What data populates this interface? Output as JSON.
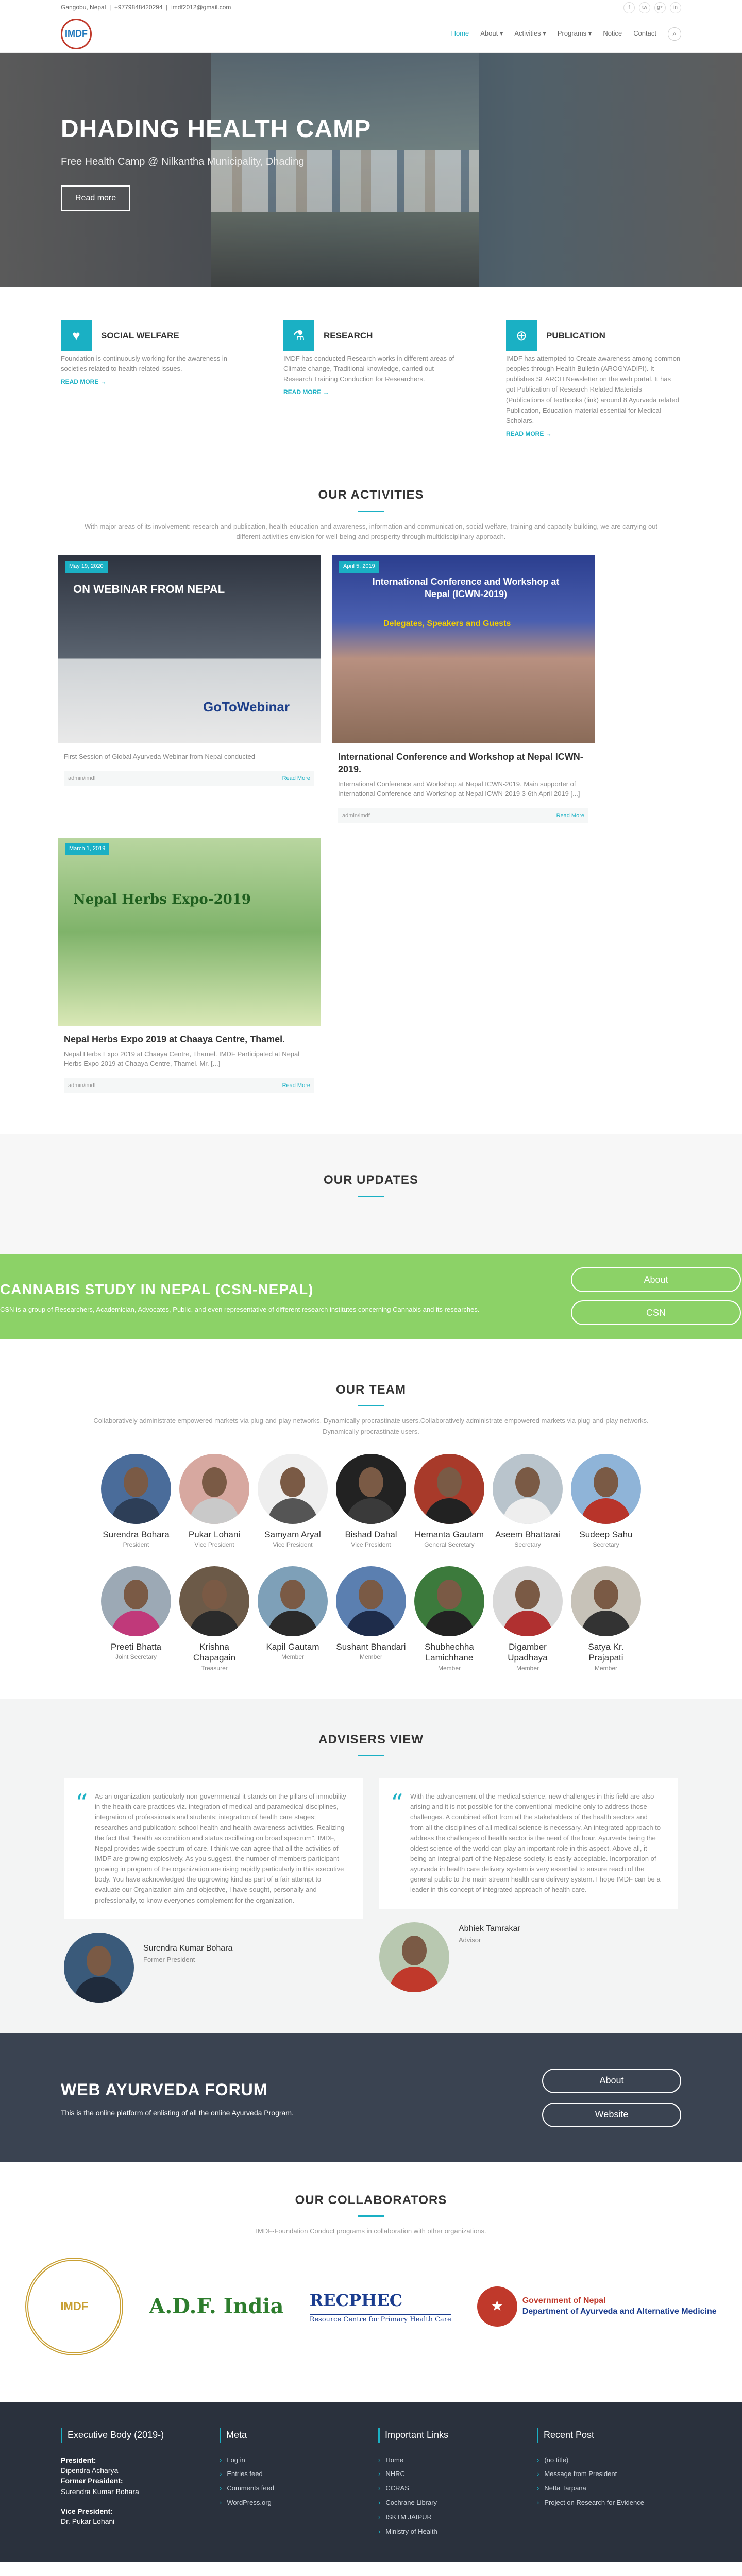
{
  "topbar": {
    "address": "Gangobu, Nepal",
    "phone": "+9779848420294",
    "email": "imdf2012@gmail.com",
    "social": [
      "f",
      "tw",
      "g+",
      "in"
    ]
  },
  "nav": {
    "logo_text": "IMDF",
    "items": [
      "Home",
      "About",
      "Activities",
      "Programs",
      "Notice",
      "Contact"
    ]
  },
  "hero": {
    "title": "DHADING HEALTH CAMP",
    "subtitle": "Free Health Camp @ Nilkantha Municipality, Dhading",
    "button": "Read more"
  },
  "features": [
    {
      "title": "SOCIAL WELFARE",
      "text": "Foundation is continuously working for the awareness in societies related to health-related issues.",
      "more": "READ MORE"
    },
    {
      "title": "RESEARCH",
      "text": "IMDF has conducted Research works in different areas of Climate change, Traditional knowledge, carried out Research Training Conduction for Researchers.",
      "more": "READ MORE"
    },
    {
      "title": "PUBLICATION",
      "text": "IMDF has attempted to Create awareness among common peoples through Health Bulletin (AROGYADIPI). It publishes SEARCH Newsletter on the web portal. It has got Publication of Research Related Materials (Publications of textbooks (link) around 8 Ayurveda related Publication, Education material essential for Medical Scholars.",
      "more": "READ MORE"
    }
  ],
  "activities": {
    "title": "OUR ACTIVITIES",
    "subtitle": "With major areas of its involvement: research and publication, health education and awareness, information and communication, social welfare, training and capacity building, we are carrying out different activities envision for well-being and prosperity through multidisciplinary approach.",
    "cards": [
      {
        "date": "May 19, 2020",
        "img_title": "ON WEBINAR FROM NEPAL",
        "img_sub": "GoToWebinar",
        "title": "",
        "text": "First Session of Global Ayurveda Webinar from Nepal conducted",
        "author": "admin/imdf",
        "more": "Read More"
      },
      {
        "date": "April 5, 2019",
        "img_title": "International Conference and Workshop at Nepal (ICWN-2019)",
        "img_sub": "Delegates, Speakers and Guests",
        "title": "International Conference and Workshop at Nepal ICWN-2019.",
        "text": "International Conference and Workshop at Nepal ICWN-2019. Main supporter of International Conference and Workshop at Nepal ICWN-2019 3-6th April 2019 [...]",
        "author": "admin/imdf",
        "more": "Read More"
      },
      {
        "date": "March 1, 2019",
        "img_title": "Nepal Herbs Expo-2019",
        "img_sub": "",
        "title": "Nepal Herbs Expo 2019 at Chaaya Centre, Thamel.",
        "text": "Nepal Herbs Expo 2019 at Chaaya Centre, Thamel. IMDF Participated at Nepal Herbs Expo 2019 at Chaaya Centre, Thamel. Mr. [...]",
        "author": "admin/imdf",
        "more": "Read More"
      }
    ]
  },
  "updates": {
    "title": "OUR UPDATES"
  },
  "cannabis": {
    "title": "CANNABIS STUDY IN NEPAL (CSN-NEPAL)",
    "text": "CSN is a group of Researchers, Academician, Advocates, Public, and even representative of different research institutes concerning Cannabis and its researches.",
    "buttons": [
      "About",
      "CSN"
    ]
  },
  "team": {
    "title": "OUR TEAM",
    "subtitle": "Collaboratively administrate empowered markets via plug-and-play networks. Dynamically procrastinate users.Collaboratively administrate empowered markets via plug-and-play networks. Dynamically procrastinate users.",
    "row1": [
      {
        "name": "Surendra Bohara",
        "role": "President"
      },
      {
        "name": "Pukar Lohani",
        "role": "Vice President"
      },
      {
        "name": "Samyam Aryal",
        "role": "Vice President"
      },
      {
        "name": "Bishad Dahal",
        "role": "Vice President"
      },
      {
        "name": "Hemanta Gautam",
        "role": "General Secretary"
      },
      {
        "name": "Aseem Bhattarai",
        "role": "Secretary"
      },
      {
        "name": "Sudeep Sahu",
        "role": "Secretary"
      }
    ],
    "row2": [
      {
        "name": "Preeti Bhatta",
        "role": "Joint Secretary"
      },
      {
        "name": "Krishna Chapagain",
        "role": "Treasurer"
      },
      {
        "name": "Kapil Gautam",
        "role": "Member"
      },
      {
        "name": "Sushant Bhandari",
        "role": "Member"
      },
      {
        "name": "Shubhechha Lamichhane",
        "role": "Member"
      },
      {
        "name": "Digamber Upadhaya",
        "role": "Member"
      },
      {
        "name": "Satya Kr. Prajapati",
        "role": "Member"
      }
    ]
  },
  "advisers": {
    "title": "ADVISERS VIEW",
    "items": [
      {
        "quote": "As an organization particularly non-governmental it stands on the pillars of immobility in the health care practices viz. integration of medical and paramedical disciplines, integration of professionals and students; integration of health care stages; researches and publication; school health and health awareness activities. Realizing the fact that \"health as condition and status oscillating on broad spectrum\", IMDF, Nepal provides wide spectrum of care. I think we can agree that all the activities of IMDF are growing explosively. As you suggest, the number of members participant growing in program of the organization are rising rapidly particularly in this executive body. You have acknowledged the upgrowing kind as part of a fair attempt to evaluate our Organization aim and objective, I have sought, personally and professionally, to know everyones complement for the organization.",
        "name": "Surendra Kumar Bohara",
        "role": "Former President"
      },
      {
        "quote": "With the advancement of the medical science, new challenges in this field are also arising and it is not possible for the conventional medicine only to address those challenges. A combined effort from all the stakeholders of the health sectors and from all the disciplines of all medical science is necessary. An integrated approach to address the challenges of health sector is the need of the hour. Ayurveda being the oldest science of the world can play an important role in this aspect. Above all, it being an integral part of the Nepalese society, is easily acceptable. Incorporation of ayurveda in health care delivery system is very essential to ensure reach of the general public to the main stream health care delivery system. I hope IMDF can be a leader in this concept of integrated approach of health care.",
        "name": "Abhiek Tamrakar",
        "role": "Advisor"
      }
    ]
  },
  "forum": {
    "title": "WEB AYURVEDA FORUM",
    "text": "This is the online platform of enlisting of all the online Ayurveda Program.",
    "buttons": [
      "About",
      "Website"
    ]
  },
  "collab": {
    "title": "OUR COLLABORATORS",
    "subtitle": "IMDF-Foundation Conduct programs in collaboration with other organizations.",
    "logos": {
      "seal": "IMDF",
      "adf": "A.D.F. India",
      "recphec": "RECPHEC",
      "recphec_sub": "Resource Centre for Primary Health Care",
      "gov1": "Government of Nepal",
      "gov2": "Department of Ayurveda and Alternative Medicine"
    }
  },
  "footer": {
    "exec": {
      "title": "Executive Body (2019-)",
      "lines": [
        "President:",
        "Dipendra Acharya",
        "Former President:",
        "Surendra Kumar Bohara",
        "",
        "Vice President:",
        "Dr. Pukar Lohani"
      ]
    },
    "meta": {
      "title": "Meta",
      "items": [
        "Log in",
        "Entries feed",
        "Comments feed",
        "WordPress.org"
      ]
    },
    "links": {
      "title": "Important Links",
      "items": [
        "Home",
        "NHRC",
        "CCRAS",
        "Cochrane Library",
        "ISKTM JAIPUR",
        "Ministry of Health"
      ]
    },
    "recent": {
      "title": "Recent Post",
      "items": [
        "(no title)",
        "Message from President",
        "Netta Tarpana",
        "Project on Research for Evidence"
      ]
    }
  }
}
